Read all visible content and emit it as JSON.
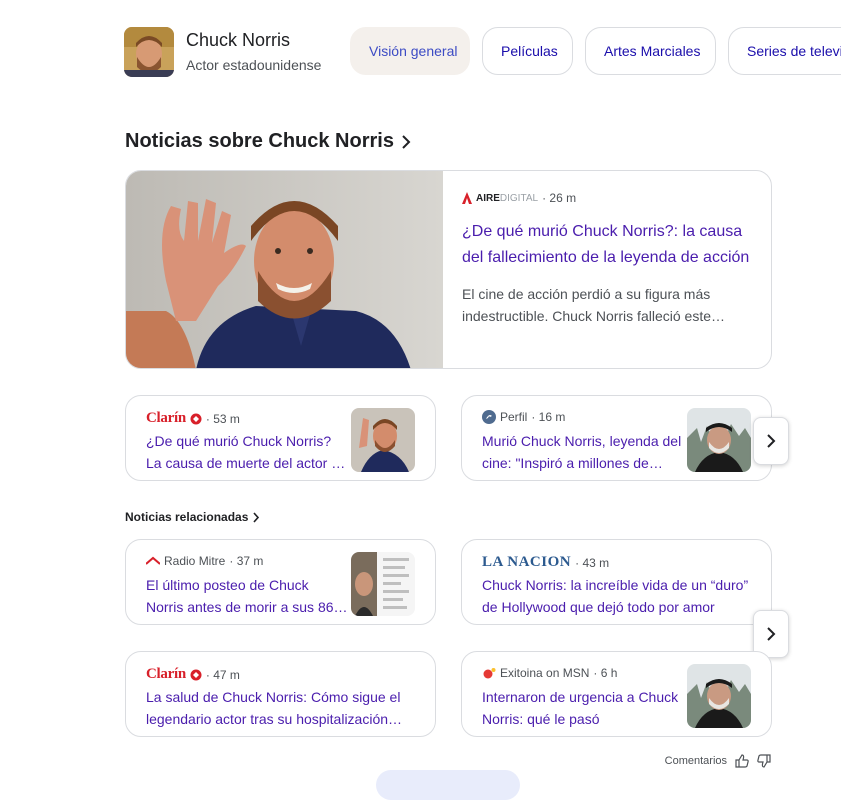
{
  "entity": {
    "name": "Chuck Norris",
    "description": "Actor estadounidense"
  },
  "chips": [
    "Visión general",
    "Películas",
    "Artes Marciales",
    "Series de televisión"
  ],
  "news_section": {
    "title": "Noticias sobre Chuck Norris"
  },
  "hero": {
    "source": "AIREDIGITAL",
    "source_bold": "AIRE",
    "source_light": "DIGITAL",
    "time": "· 26 m",
    "title": "¿De qué murió Chuck Norris?: la causa del fallecimiento de la leyenda de acción",
    "snippet": "El cine de acción perdió a su figura más indestructible. Chuck Norris falleció este…"
  },
  "top_cards": [
    {
      "source": "Clarín",
      "time": "· 53 m",
      "title_l1": "¿De qué murió Chuck Norris?",
      "title_l2": "La causa de muerte del actor …"
    },
    {
      "source": "Perfil",
      "time": "· 16 m",
      "title_l1": "Murió Chuck Norris, leyenda del",
      "title_l2": "cine: \"Inspiró a millones de…"
    }
  ],
  "related_section": {
    "title": "Noticias relacionadas"
  },
  "related_cards": [
    {
      "source": "Radio Mitre",
      "time": "· 37 m",
      "title_l1": "El último posteo de Chuck",
      "title_l2": "Norris antes de morir a sus 86…"
    },
    {
      "source": "LA NACION",
      "time": "· 43 m",
      "title_l1": "Chuck Norris: la increíble vida de un “duro”",
      "title_l2": "de Hollywood que dejó todo por amor"
    },
    {
      "source": "Clarín",
      "time": "· 47 m",
      "title_l1": "La salud de Chuck Norris: Cómo sigue el",
      "title_l2": "legendario actor tras su hospitalización…"
    },
    {
      "source": "Exitoina on MSN",
      "time": "· 6 h",
      "title_l1": "Internaron de urgencia a Chuck",
      "title_l2": "Norris: qué le pasó"
    }
  ],
  "footer": {
    "feedback_label": "Comentarios"
  },
  "colors": {
    "link": "#4a1dad",
    "clarin": "#d8202a",
    "border": "#dadce0"
  }
}
